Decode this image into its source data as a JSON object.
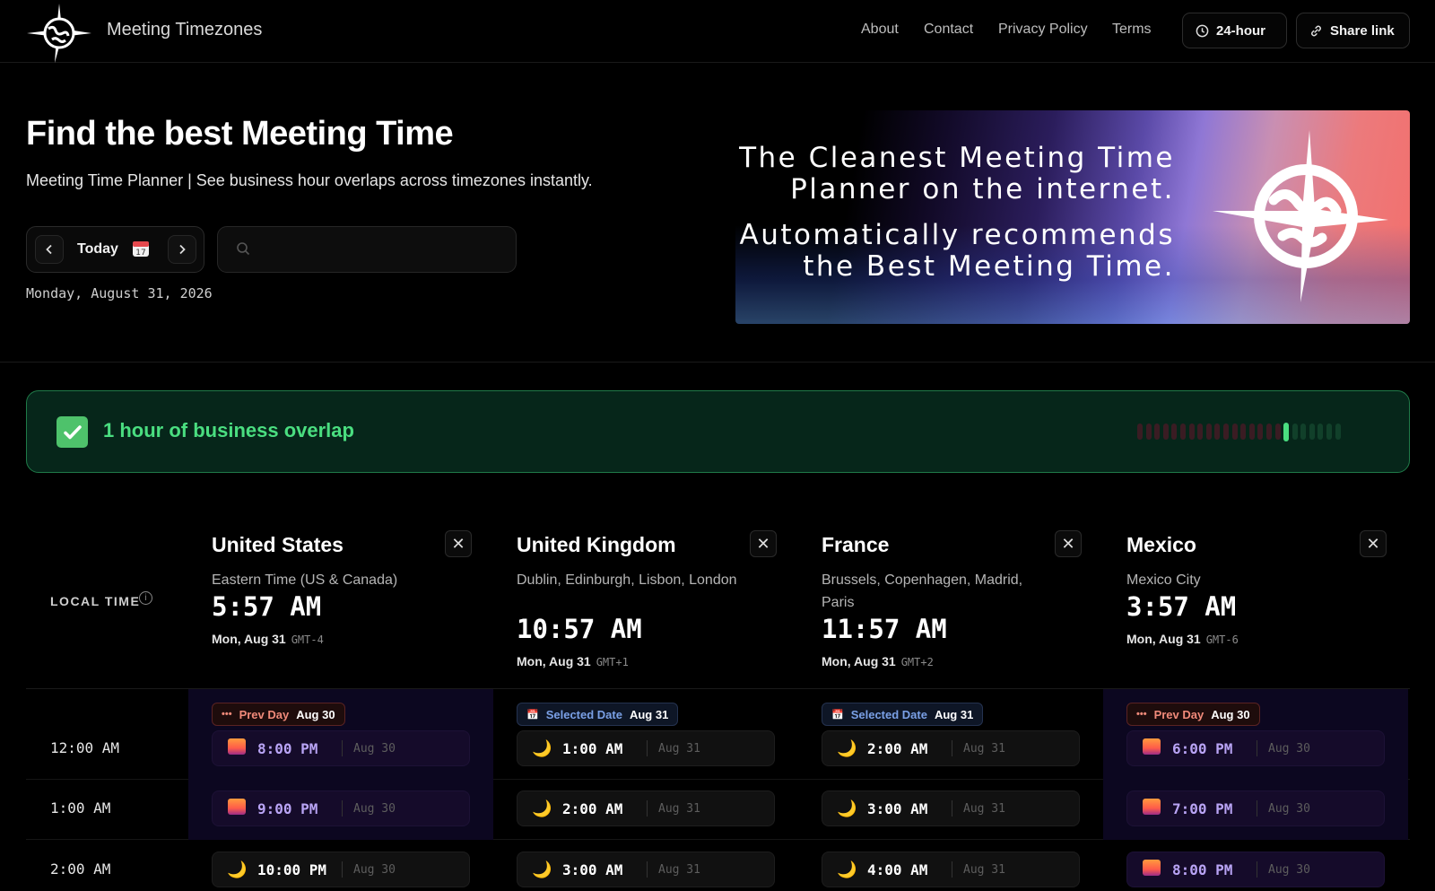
{
  "header": {
    "brand": "Meeting Timezones",
    "nav": [
      "About",
      "Contact",
      "Privacy Policy",
      "Terms"
    ],
    "clock_button": "24-hour",
    "share_button": "Share link"
  },
  "hero": {
    "title": "Find the best Meeting Time",
    "subtitle": "Meeting Time Planner | See business hour overlaps across timezones instantly.",
    "today_label": "Today",
    "date_text": "Monday, August 31, 2026",
    "search_placeholder": "",
    "banner_line1": "The Cleanest Meeting Time",
    "banner_line2": "Planner on the internet.",
    "banner_line3": "Automatically recommends",
    "banner_line4": "the Best Meeting Time."
  },
  "overlap": {
    "text": "1 hour of business overlap",
    "hours_total": 24,
    "overlap_hour_index": 17
  },
  "table": {
    "local_time_label": "LOCAL TIME",
    "columns": [
      {
        "country": "United States",
        "region": "Eastern Time (US & Canada)",
        "time": "5:57 AM",
        "date": "Mon, Aug 31",
        "gmt": "GMT-4",
        "tag_kind": "prev",
        "tag_label": "Prev Day",
        "tag_date": "Aug 30",
        "rows": [
          {
            "icon": "sunset",
            "time": "8:00 PM",
            "date": "Aug 30"
          },
          {
            "icon": "sunset",
            "time": "9:00 PM",
            "date": "Aug 30"
          },
          {
            "icon": "moon",
            "time": "10:00 PM",
            "date": "Aug 30"
          }
        ]
      },
      {
        "country": "United Kingdom",
        "region": "Dublin, Edinburgh, Lisbon, London",
        "time": "10:57 AM",
        "date": "Mon, Aug 31",
        "gmt": "GMT+1",
        "tag_kind": "sel",
        "tag_label": "Selected Date",
        "tag_date": "Aug 31",
        "rows": [
          {
            "icon": "moon",
            "time": "1:00 AM",
            "date": "Aug 31"
          },
          {
            "icon": "moon",
            "time": "2:00 AM",
            "date": "Aug 31"
          },
          {
            "icon": "moon",
            "time": "3:00 AM",
            "date": "Aug 31"
          }
        ]
      },
      {
        "country": "France",
        "region": "Brussels, Copenhagen, Madrid, Paris",
        "time": "11:57 AM",
        "date": "Mon, Aug 31",
        "gmt": "GMT+2",
        "tag_kind": "sel",
        "tag_label": "Selected Date",
        "tag_date": "Aug 31",
        "rows": [
          {
            "icon": "moon",
            "time": "2:00 AM",
            "date": "Aug 31"
          },
          {
            "icon": "moon",
            "time": "3:00 AM",
            "date": "Aug 31"
          },
          {
            "icon": "moon",
            "time": "4:00 AM",
            "date": "Aug 31"
          }
        ]
      },
      {
        "country": "Mexico",
        "region": "Mexico City",
        "time": "3:57 AM",
        "date": "Mon, Aug 31",
        "gmt": "GMT-6",
        "tag_kind": "prev",
        "tag_label": "Prev Day",
        "tag_date": "Aug 30",
        "rows": [
          {
            "icon": "sunset",
            "time": "6:00 PM",
            "date": "Aug 30"
          },
          {
            "icon": "sunset",
            "time": "7:00 PM",
            "date": "Aug 30"
          },
          {
            "icon": "sunset",
            "time": "8:00 PM",
            "date": "Aug 30"
          }
        ]
      }
    ],
    "row_labels": [
      "12:00 AM",
      "1:00 AM",
      "2:00 AM"
    ]
  }
}
